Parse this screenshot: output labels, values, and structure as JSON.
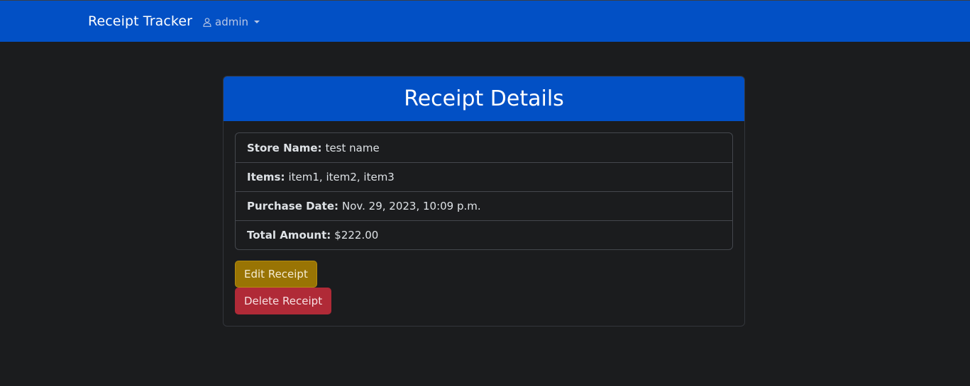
{
  "navbar": {
    "brand": "Receipt Tracker",
    "user": {
      "icon": "person-icon",
      "name": "admin"
    },
    "color": "#0250c5"
  },
  "card": {
    "title": "Receipt Details",
    "fields": [
      {
        "label": "Store Name:",
        "value": "test name"
      },
      {
        "label": "Items:",
        "value": "item1, item2, item3"
      },
      {
        "label": "Purchase Date:",
        "value": "Nov. 29, 2023, 10:09 p.m."
      },
      {
        "label": "Total Amount:",
        "value": "$222.00"
      }
    ],
    "actions": {
      "edit_label": "Edit Receipt",
      "delete_label": "Delete Receipt",
      "edit_color": "#997404",
      "delete_color": "#b02a37"
    }
  }
}
